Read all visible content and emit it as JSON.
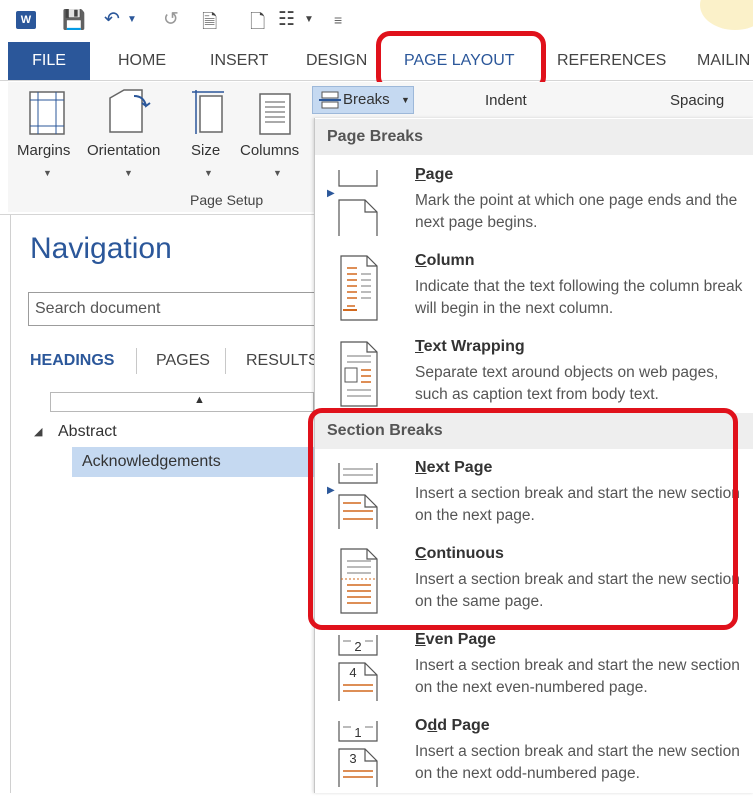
{
  "quick_access": {
    "icons": [
      "word-app-icon",
      "save-icon",
      "undo-icon",
      "redo-icon",
      "print-preview-icon",
      "new-document-icon",
      "breaks-toolbar-icon",
      "customize-qat-icon"
    ],
    "word_letter": "W"
  },
  "tabs": {
    "file": "FILE",
    "home": "HOME",
    "insert": "INSERT",
    "design": "DESIGN",
    "page_layout": "PAGE LAYOUT",
    "references": "REFERENCES",
    "mailings": "MAILIN"
  },
  "ribbon": {
    "margins": "Margins",
    "orientation": "Orientation",
    "size": "Size",
    "columns": "Columns",
    "breaks": "Breaks",
    "indent": "Indent",
    "spacing": "Spacing",
    "group_label": "Page Setup"
  },
  "navigation": {
    "title": "Navigation",
    "search_placeholder": "Search document",
    "tabs": [
      "HEADINGS",
      "PAGES",
      "RESULTS"
    ],
    "outline": {
      "level1": "Abstract",
      "level2": "Acknowledgements"
    }
  },
  "breaks_menu": {
    "page_breaks_header": "Page Breaks",
    "section_breaks_header": "Section Breaks",
    "items": [
      {
        "title_before": "",
        "title_under": "P",
        "title_after": "age",
        "desc": "Mark the point at which one page ends and the next page begins."
      },
      {
        "title_before": "",
        "title_under": "C",
        "title_after": "olumn",
        "desc": "Indicate that the text following the column break will begin in the next column."
      },
      {
        "title_before": "",
        "title_under": "T",
        "title_after": "ext Wrapping",
        "desc": "Separate text around objects on web pages, such as caption text from body text."
      },
      {
        "title_before": "",
        "title_under": "N",
        "title_after": "ext Page",
        "desc": "Insert a section break and start the new section on the next page."
      },
      {
        "title_before": "",
        "title_under": "C",
        "title_after": "ontinuous",
        "desc": "Insert a section break and start the new section on the same page."
      },
      {
        "title_before": "",
        "title_under": "E",
        "title_after": "ven Page",
        "desc": "Insert a section break and start the new section on the next even-numbered page."
      },
      {
        "title_before": "O",
        "title_under": "d",
        "title_after": "d Page",
        "desc": "Insert a section break and start the new section on the next odd-numbered page."
      }
    ],
    "icon_numbers": {
      "even_top": "2",
      "even_bottom": "4",
      "odd_top": "1",
      "odd_bottom": "3"
    }
  },
  "colors": {
    "accent": "#2b579a",
    "highlight": "#e0111b",
    "selected_row": "#c5d9f1"
  }
}
